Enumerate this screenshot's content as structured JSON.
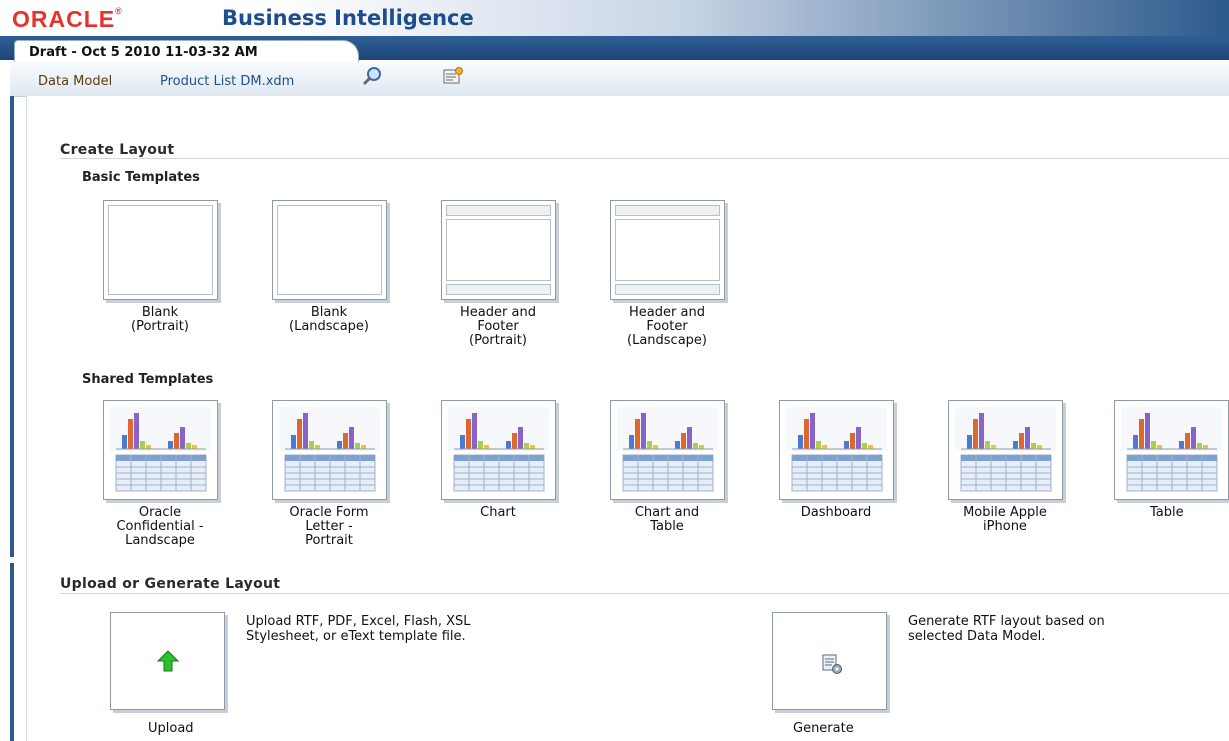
{
  "app": {
    "brand": "ORACLE",
    "title": "Business Intelligence"
  },
  "tab": {
    "label": "Draft - Oct 5 2010 11-03-32 AM"
  },
  "breadcrumb": {
    "data_model_label": "Data Model",
    "data_model_name": "Product List DM.xdm",
    "search_icon": "magnifier-icon",
    "properties_icon": "properties-icon"
  },
  "create_layout": {
    "title": "Create Layout",
    "basic_templates": {
      "title": "Basic Templates",
      "items": [
        {
          "label": "Blank\n(Portrait)",
          "style": "blank"
        },
        {
          "label": "Blank\n(Landscape)",
          "style": "blank"
        },
        {
          "label": "Header and\nFooter\n(Portrait)",
          "style": "header-footer"
        },
        {
          "label": "Header and\nFooter\n(Landscape)",
          "style": "header-footer"
        }
      ]
    },
    "shared_templates": {
      "title": "Shared Templates",
      "items": [
        {
          "label": "Oracle\nConfidential -\nLandscape"
        },
        {
          "label": "Oracle Form\nLetter -\nPortrait"
        },
        {
          "label": "Chart"
        },
        {
          "label": "Chart and\nTable"
        },
        {
          "label": "Dashboard"
        },
        {
          "label": "Mobile Apple\niPhone"
        },
        {
          "label": "Table"
        }
      ]
    }
  },
  "upload_generate": {
    "title": "Upload or Generate Layout",
    "upload": {
      "label": "Upload",
      "description": "Upload RTF, PDF, Excel, Flash, XSL\nStylesheet, or eText template file.",
      "icon": "upload-arrow-icon"
    },
    "generate": {
      "label": "Generate",
      "description": "Generate RTF layout based on\nselected Data Model.",
      "icon": "generate-document-icon"
    }
  },
  "colors": {
    "brand_red": "#e8312a",
    "title_blue": "#1d4d8f",
    "header_blue": "#2d5a8c",
    "link_blue": "#1f4f8f"
  }
}
